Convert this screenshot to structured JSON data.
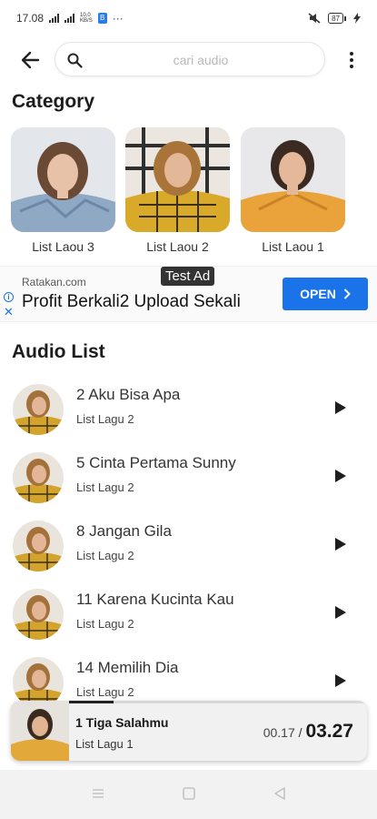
{
  "status_bar": {
    "time": "17.08",
    "net_speed_top": "10,0",
    "net_speed_bottom": "KB/S",
    "bluetooth_glyph": "B",
    "more_glyph": "···",
    "battery_level": "87"
  },
  "header": {
    "search_placeholder": "cari audio"
  },
  "category": {
    "heading": "Category",
    "items": [
      {
        "label": "List Laou 3"
      },
      {
        "label": "List Laou 2"
      },
      {
        "label": "List Laou 1"
      }
    ]
  },
  "ad": {
    "badge": "Test Ad",
    "domain": "Ratakan.com",
    "headline": "Profit Berkali2 Upload Sekali",
    "cta": "OPEN",
    "info_glyph": "i",
    "close_glyph": "✕"
  },
  "audio_list": {
    "heading": "Audio List",
    "items": [
      {
        "title": "2 Aku Bisa Apa",
        "subtitle": "List Lagu 2"
      },
      {
        "title": "5 Cinta Pertama Sunny",
        "subtitle": "List Lagu 2"
      },
      {
        "title": "8 Jangan Gila",
        "subtitle": "List Lagu 2"
      },
      {
        "title": "11 Karena Kucinta Kau",
        "subtitle": "List Lagu 2"
      },
      {
        "title": "14 Memilih Dia",
        "subtitle": "List Lagu 2"
      }
    ]
  },
  "player": {
    "title": "1 Tiga Salahmu",
    "subtitle": "List Lagu 1",
    "current_time": "00.17",
    "separator": " / ",
    "total_time": "03.27",
    "progress_fraction": 0.15
  },
  "colors": {
    "accent": "#1a73e8",
    "text": "#1f1f1f",
    "player_bg": "#f1f1f1",
    "nav_bg": "#f2f2f2"
  },
  "icons": {
    "back": "arrow-left-icon",
    "search": "search-icon",
    "more": "more-vertical-icon",
    "play": "play-icon",
    "nav_menu": "menu-icon",
    "nav_home": "home-icon",
    "nav_back": "back-triangle-icon"
  }
}
